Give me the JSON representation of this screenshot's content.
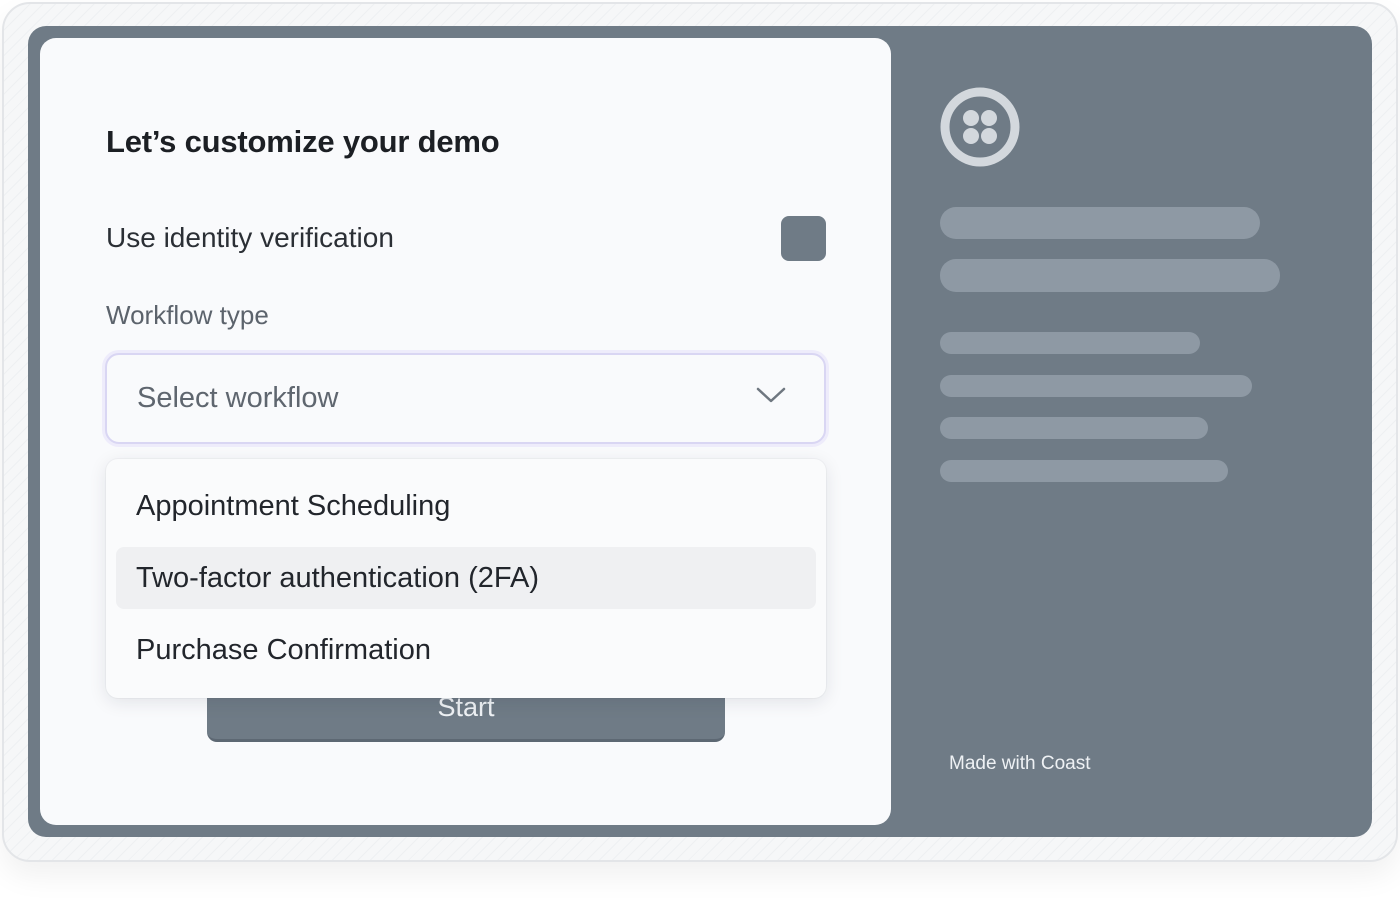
{
  "modal": {
    "title": "Let’s customize your demo",
    "identity_toggle_label": "Use identity verification",
    "workflow_label": "Workflow type",
    "select_placeholder": "Select workflow",
    "options": [
      {
        "label": "Appointment Scheduling",
        "highlighted": false
      },
      {
        "label": "Two-factor authentication (2FA)",
        "highlighted": true
      },
      {
        "label": "Purchase Confirmation",
        "highlighted": false
      }
    ],
    "start_label": "Start"
  },
  "side_panel": {
    "logo_icon": "twilio-logo-icon",
    "footer_text": "Made with Coast"
  },
  "colors": {
    "panel_gray": "#6f7b86",
    "skeleton_gray": "#8e99a4",
    "card_bg": "#f9fafc",
    "select_focus": "#d9d6f3"
  }
}
